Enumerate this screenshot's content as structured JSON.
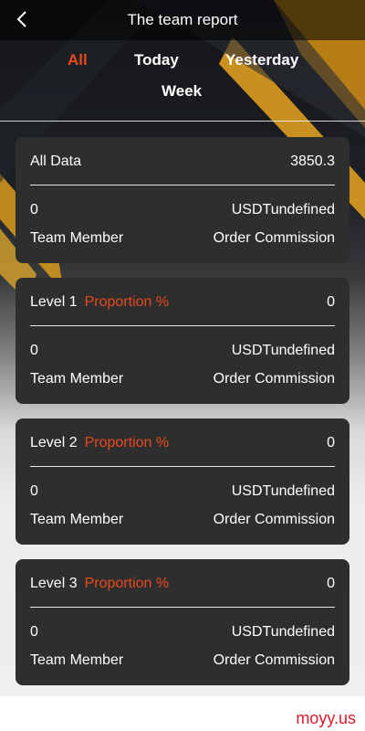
{
  "header": {
    "title": "The team report"
  },
  "tabs": [
    {
      "label": "All",
      "active": true
    },
    {
      "label": "Today",
      "active": false
    },
    {
      "label": "Yesterday",
      "active": false
    },
    {
      "label": "Week",
      "active": false
    }
  ],
  "summary": {
    "label": "All Data",
    "value": "3850.3",
    "team_count": "0",
    "commission_value": "USDTundefined",
    "team_label": "Team Member",
    "commission_label": "Order Commission"
  },
  "levels": [
    {
      "label": "Level 1",
      "proportion_label": "Proportion %",
      "proportion_value": "0",
      "team_count": "0",
      "commission_value": "USDTundefined",
      "team_label": "Team Member",
      "commission_label": "Order Commission"
    },
    {
      "label": "Level 2",
      "proportion_label": "Proportion %",
      "proportion_value": "0",
      "team_count": "0",
      "commission_value": "USDTundefined",
      "team_label": "Team Member",
      "commission_label": "Order Commission"
    },
    {
      "label": "Level 3",
      "proportion_label": "Proportion %",
      "proportion_value": "0",
      "team_count": "0",
      "commission_value": "USDTundefined",
      "team_label": "Team Member",
      "commission_label": "Order Commission"
    }
  ],
  "watermark": "moyy.us",
  "colors": {
    "accent": "#e8491d",
    "card": "#2e2e2e",
    "watermark": "#e0192b"
  },
  "icons": {
    "back": "chevron-left-icon"
  }
}
